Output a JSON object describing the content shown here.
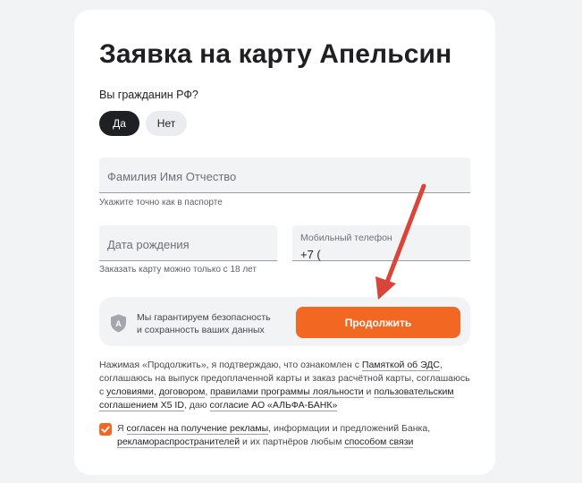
{
  "form": {
    "title": "Заявка на карту Апельсин",
    "citizen_question": "Вы гражданин РФ?",
    "citizen_yes": "Да",
    "citizen_no": "Нет",
    "fio_placeholder": "Фамилия Имя Отчество",
    "fio_hint": "Укажите точно как в паспорте",
    "birth_placeholder": "Дата рождения",
    "birth_hint": "Заказать карту можно только с 18 лет",
    "phone_label": "Мобильный телефон",
    "phone_value": "+7 ("
  },
  "promo": {
    "shield_letter": "A",
    "line1": "Мы гарантируем безопасность",
    "line2": "и сохранность ваших данных",
    "continue_label": "Продолжить"
  },
  "legal": {
    "t1": "Нажимая «Продолжить», я подтверждаю, что ознакомлен с ",
    "l1": "Памяткой об ЭДС",
    "t2": ", соглашаюсь на выпуск предоплаченной карты и заказ расчётной карты, соглашаюсь с ",
    "l2": "условиями",
    "t3": ", ",
    "l3": "договором",
    "t4": ", ",
    "l4": "правилами программы лояльности",
    "t5": " и ",
    "l5": "пользовательским соглашением X5 ID",
    "t6": ", даю ",
    "l6": "согласие АО «АЛЬФА-БАНК»"
  },
  "consent": {
    "t1": "Я ",
    "l1": "согласен на получение рекламы",
    "t2": ", информации и предложений Банка, ",
    "l2": "рекламораспространителей",
    "t3": " и их партнёров любым ",
    "l3": "способом связи"
  },
  "colors": {
    "accent": "#f26722",
    "arrow": "#d9453a",
    "dark": "#1f2024"
  }
}
